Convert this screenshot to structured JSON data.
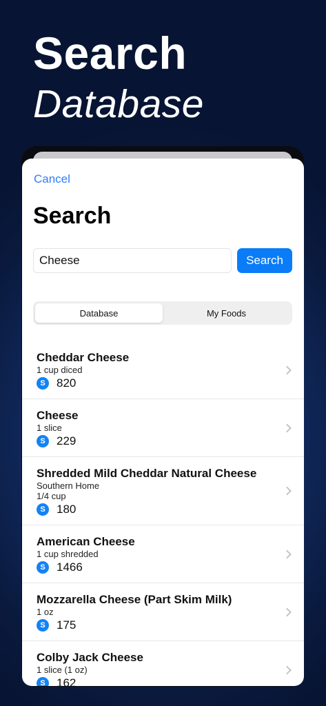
{
  "hero": {
    "title": "Search",
    "subtitle": "Database"
  },
  "sheet": {
    "cancel_label": "Cancel",
    "title": "Search",
    "search": {
      "value": "Cheese",
      "button_label": "Search"
    },
    "segments": [
      {
        "label": "Database",
        "selected": true
      },
      {
        "label": "My Foods",
        "selected": false
      }
    ],
    "badge_label": "S",
    "results": [
      {
        "name": "Cheddar Cheese",
        "lines": [
          "1 cup diced"
        ],
        "calories": "820"
      },
      {
        "name": "Cheese",
        "lines": [
          "1 slice"
        ],
        "calories": "229"
      },
      {
        "name": "Shredded Mild Cheddar Natural Cheese",
        "lines": [
          "Southern Home",
          "1/4 cup"
        ],
        "calories": "180"
      },
      {
        "name": "American Cheese",
        "lines": [
          "1 cup shredded"
        ],
        "calories": "1466"
      },
      {
        "name": "Mozzarella Cheese (Part Skim Milk)",
        "lines": [
          "1 oz"
        ],
        "calories": "175"
      },
      {
        "name": "Colby Jack Cheese",
        "lines": [
          "1 slice (1 oz)"
        ],
        "calories": "162"
      }
    ]
  },
  "colors": {
    "accent": "#0a7cf7",
    "badge": "#1283f5",
    "background": "#112b60"
  },
  "icons": {
    "chevron": "chevron-right-icon"
  }
}
